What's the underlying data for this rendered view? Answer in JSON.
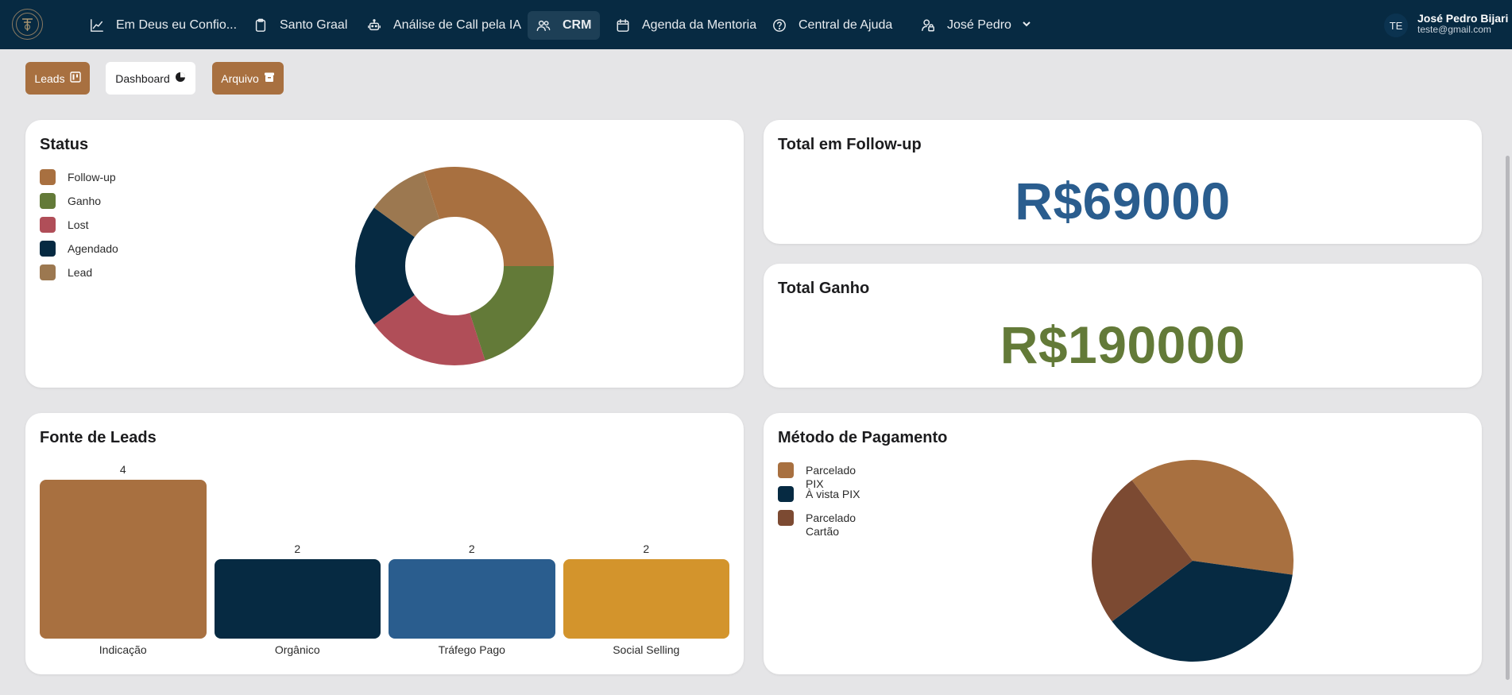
{
  "nav": {
    "items": [
      {
        "label": "Em Deus eu Confio...",
        "icon": "chart-line-icon"
      },
      {
        "label": "Santo Graal",
        "icon": "clipboard-icon"
      },
      {
        "label": "Análise de Call pela IA",
        "icon": "robot-icon"
      },
      {
        "label": "CRM",
        "icon": "users-icon",
        "active": true
      },
      {
        "label": "Agenda da Mentoria",
        "icon": "calendar-icon"
      },
      {
        "label": "Central de Ajuda",
        "icon": "help-circle-icon"
      },
      {
        "label": "José Pedro",
        "icon": "user-lock-icon"
      }
    ],
    "user": {
      "initials": "TE",
      "name": "José Pedro Bijari",
      "email": "teste@gmail.com"
    }
  },
  "tabs": {
    "leads": "Leads",
    "dashboard": "Dashboard",
    "arquivo": "Arquivo"
  },
  "status_card": {
    "title": "Status",
    "legend": [
      {
        "label": "Follow-up",
        "color": "#a87040"
      },
      {
        "label": "Ganho",
        "color": "#637a38"
      },
      {
        "label": "Lost",
        "color": "#b04e58"
      },
      {
        "label": "Agendado",
        "color": "#062a42"
      },
      {
        "label": "Lead",
        "color": "#9c7850"
      }
    ]
  },
  "followup_card": {
    "title": "Total em Follow-up",
    "value": "R$69000",
    "color": "#2a5d8e"
  },
  "ganho_card": {
    "title": "Total Ganho",
    "value": "R$190000",
    "color": "#637a38"
  },
  "fonte_card": {
    "title": "Fonte de Leads"
  },
  "pagamento_card": {
    "title": "Método de Pagamento",
    "legend": [
      {
        "label": "Parcelado PIX",
        "color": "#a87040"
      },
      {
        "label": "À vista PIX",
        "color": "#062a42"
      },
      {
        "label": "Parcelado Cartão",
        "color": "#7c4a32"
      }
    ]
  },
  "chart_data": [
    {
      "type": "pie",
      "variant": "donut",
      "title": "Status",
      "categories": [
        "Follow-up",
        "Ganho",
        "Lost",
        "Agendado",
        "Lead"
      ],
      "values": [
        3,
        2,
        2,
        2,
        1
      ],
      "colors": [
        "#a87040",
        "#637a38",
        "#b04e58",
        "#062a42",
        "#9c7850"
      ]
    },
    {
      "type": "bar",
      "title": "Fonte de Leads",
      "categories": [
        "Indicação",
        "Orgânico",
        "Tráfego Pago",
        "Social Selling"
      ],
      "values": [
        4,
        2,
        2,
        2
      ],
      "colors": [
        "#a87040",
        "#062a42",
        "#2a5d8e",
        "#d3942c"
      ]
    },
    {
      "type": "pie",
      "title": "Método de Pagamento",
      "categories": [
        "Parcelado PIX",
        "À vista PIX",
        "Parcelado Cartão"
      ],
      "values": [
        3,
        3,
        2
      ],
      "colors": [
        "#a87040",
        "#062a42",
        "#7c4a32"
      ]
    }
  ]
}
